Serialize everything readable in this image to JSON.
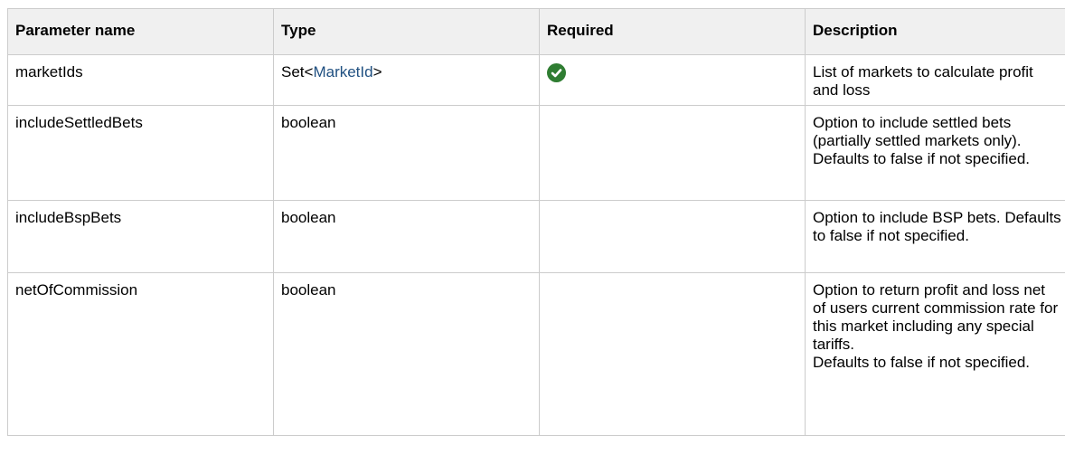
{
  "headers": {
    "name": "Parameter name",
    "type": "Type",
    "required": "Required",
    "description": "Description"
  },
  "rows": [
    {
      "name": "marketIds",
      "type_prefix": "Set<",
      "type_link": "MarketId",
      "type_suffix": ">",
      "required": true,
      "required_icon": "check-circle-icon",
      "description": "List of markets to calculate profit and loss"
    },
    {
      "name": "includeSettledBets",
      "type": "boolean",
      "required": false,
      "description": "Option to include settled bets (partially settled markets only). Defaults to false if not specified."
    },
    {
      "name": "includeBspBets",
      "type": "boolean",
      "required": false,
      "description": "Option to include BSP bets. Defaults to false if not specified."
    },
    {
      "name": "netOfCommission",
      "type": "boolean",
      "required": false,
      "description": "Option to return profit and loss net of users current commission rate for this market including any special tariffs.",
      "description_extra": "Defaults to false if not specified."
    }
  ],
  "colors": {
    "header_bg": "#f0f0f0",
    "border": "#cccccc",
    "link": "#205081",
    "check": "#2f7d32"
  }
}
